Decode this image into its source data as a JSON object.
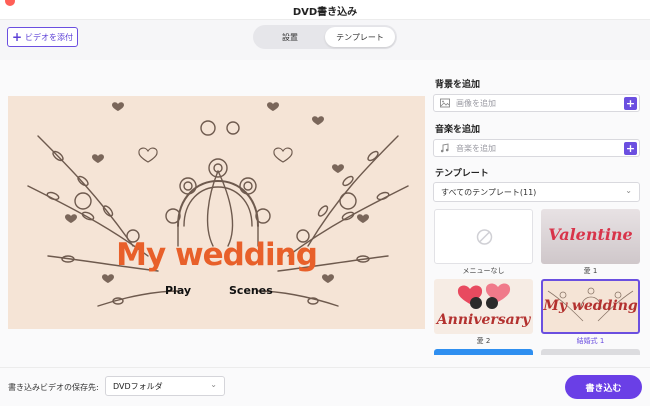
{
  "window": {
    "title": "DVD書き込み"
  },
  "toolbar": {
    "add_video_label": "ビデオを添付",
    "tabs": [
      {
        "label": "設置"
      },
      {
        "label": "テンプレート"
      }
    ]
  },
  "preview": {
    "title": "My wedding",
    "menu_play": "Play",
    "menu_scenes": "Scenes"
  },
  "sidebar": {
    "background": {
      "label": "背景を追加",
      "placeholder": "画像を追加"
    },
    "music": {
      "label": "音楽を追加",
      "placeholder": "音楽を追加"
    },
    "template": {
      "label": "テンプレート",
      "filter_value": "すべてのテンプレート(11)",
      "items": [
        {
          "caption": "メニューなし"
        },
        {
          "caption": "愛 1",
          "thumb_text": "Valentine"
        },
        {
          "caption": "愛 2",
          "thumb_text": "Anniversary"
        },
        {
          "caption": "結婚式 1",
          "thumb_text": "My wedding"
        }
      ]
    }
  },
  "bottom": {
    "save_label": "書き込みビデオの保存先:",
    "save_value": "DVDフォルダ",
    "burn_label": "書き込む"
  },
  "colors": {
    "accent": "#6b4fe0",
    "title_orange": "#e8602a",
    "preview_bg": "#f5e4d6"
  }
}
